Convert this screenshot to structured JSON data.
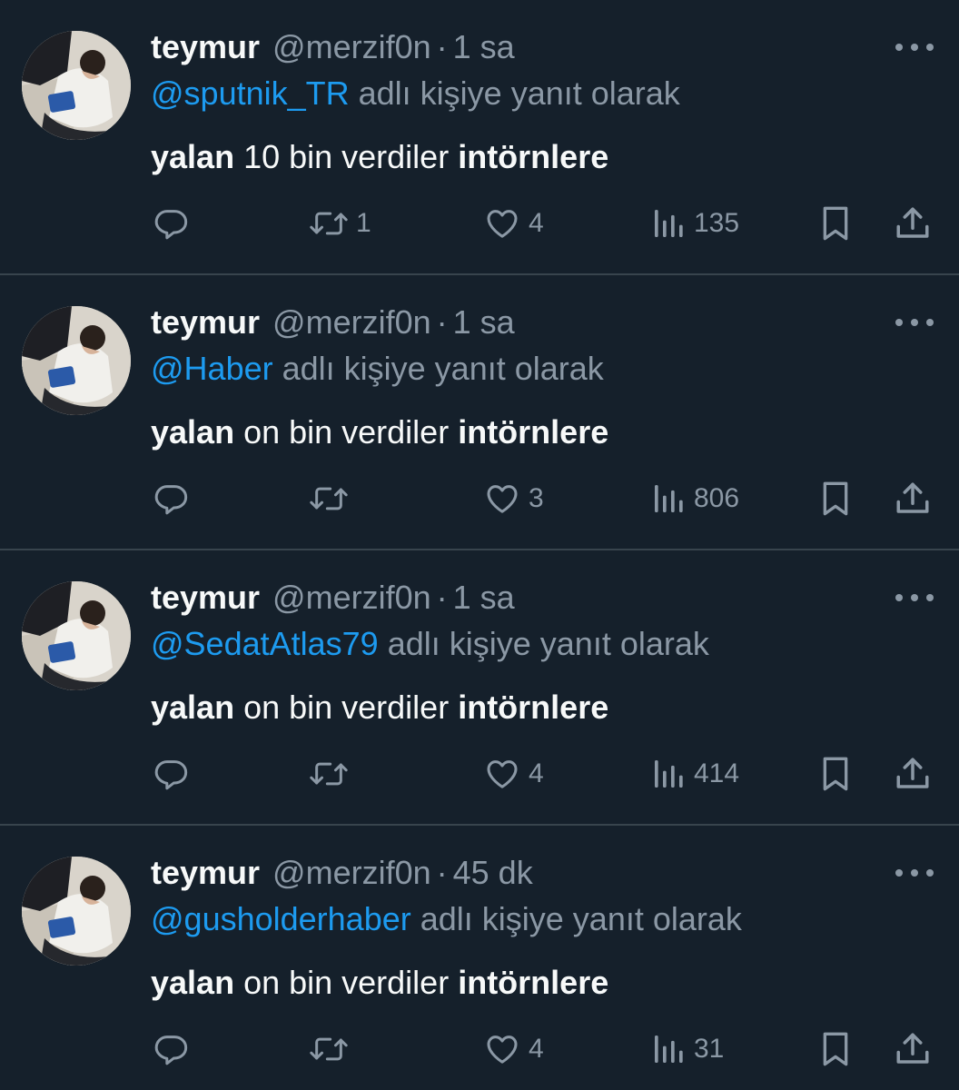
{
  "tweets": [
    {
      "author_name": "teymur",
      "handle": "@merzif0n",
      "separator": "·",
      "time": "1 sa",
      "reply_mention": "@sputnik_TR",
      "reply_suffix": " adlı kişiye yanıt olarak",
      "text_part1": "yalan",
      "text_part2": " 10 bin verdiler ",
      "text_part3": "intörnlere",
      "retweets": "1",
      "likes": "4",
      "views": "135"
    },
    {
      "author_name": "teymur",
      "handle": "@merzif0n",
      "separator": "·",
      "time": "1 sa",
      "reply_mention": "@Haber",
      "reply_suffix": " adlı kişiye yanıt olarak",
      "text_part1": "yalan",
      "text_part2": " on bin verdiler ",
      "text_part3": "intörnlere",
      "retweets": "",
      "likes": "3",
      "views": "806"
    },
    {
      "author_name": "teymur",
      "handle": "@merzif0n",
      "separator": "·",
      "time": "1 sa",
      "reply_mention": "@SedatAtlas79",
      "reply_suffix": " adlı kişiye yanıt olarak",
      "text_part1": "yalan",
      "text_part2": " on bin verdiler ",
      "text_part3": "intörnlere",
      "retweets": "",
      "likes": "4",
      "views": "414"
    },
    {
      "author_name": "teymur",
      "handle": "@merzif0n",
      "separator": "·",
      "time": "45 dk",
      "reply_mention": "@gusholderhaber",
      "reply_suffix": " adlı kişiye yanıt olarak",
      "text_part1": "yalan",
      "text_part2": " on bin verdiler ",
      "text_part3": "intörnlere",
      "retweets": "",
      "likes": "4",
      "views": "31"
    }
  ],
  "icons": {
    "reply": "reply-icon",
    "retweet": "retweet-icon",
    "like": "heart-icon",
    "views": "views-icon",
    "bookmark": "bookmark-icon",
    "share": "share-icon",
    "more": "more-icon"
  },
  "colors": {
    "background": "#15202b",
    "divider": "#38444d",
    "primary_text": "#f7f9f9",
    "secondary_text": "#8b98a5",
    "link": "#1d9bf0"
  }
}
